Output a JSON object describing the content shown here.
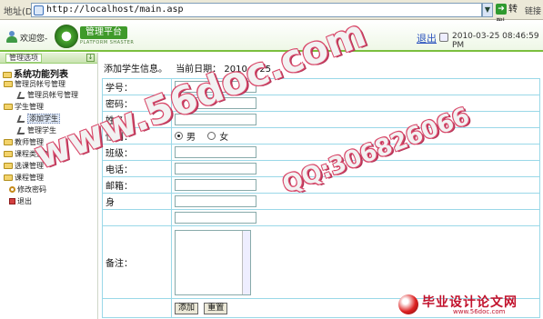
{
  "browser": {
    "address_label": "地址(D)",
    "url": "http://localhost/main.asp",
    "go_label": "转到",
    "links_label": "链接"
  },
  "header": {
    "welcome": "欢迎您-",
    "logo_text": "管理平台",
    "logo_subtext": "PLATFORM SHASTER",
    "logout": "退出",
    "datetime": "2010-03-25 08:46:59 PM"
  },
  "sidebar": {
    "tab_label": "管理选项",
    "root": "系统功能列表",
    "items": [
      {
        "label": "管理员帐号管理"
      },
      {
        "label": "管理员帐号管理"
      },
      {
        "label": "学生管理"
      },
      {
        "label": "添加学生"
      },
      {
        "label": "管理学生"
      },
      {
        "label": "教师管理"
      },
      {
        "label": "课程类别管理"
      },
      {
        "label": "选课管理"
      },
      {
        "label": "课程管理"
      },
      {
        "label": "修改密码"
      },
      {
        "label": "退出"
      }
    ]
  },
  "main": {
    "title": "添加学生信息。",
    "date_label": "当前日期：",
    "date_value": "2010-3-25",
    "fields": {
      "id": "学号：",
      "password": "密码：",
      "name": "姓名：",
      "sex": "性别：",
      "class": "班级：",
      "phone": "电话：",
      "email": "邮箱：",
      "row8": "身",
      "row9": "",
      "remark": "备注："
    },
    "sex_options": {
      "male": "男",
      "female": "女"
    },
    "buttons": {
      "add": "添加",
      "reset": "重置"
    }
  },
  "watermarks": {
    "main": "www.56doc.com",
    "qq": "QQ:306826066",
    "footer_title": "毕业设计论文网",
    "footer_url": "www.56doc.com"
  }
}
